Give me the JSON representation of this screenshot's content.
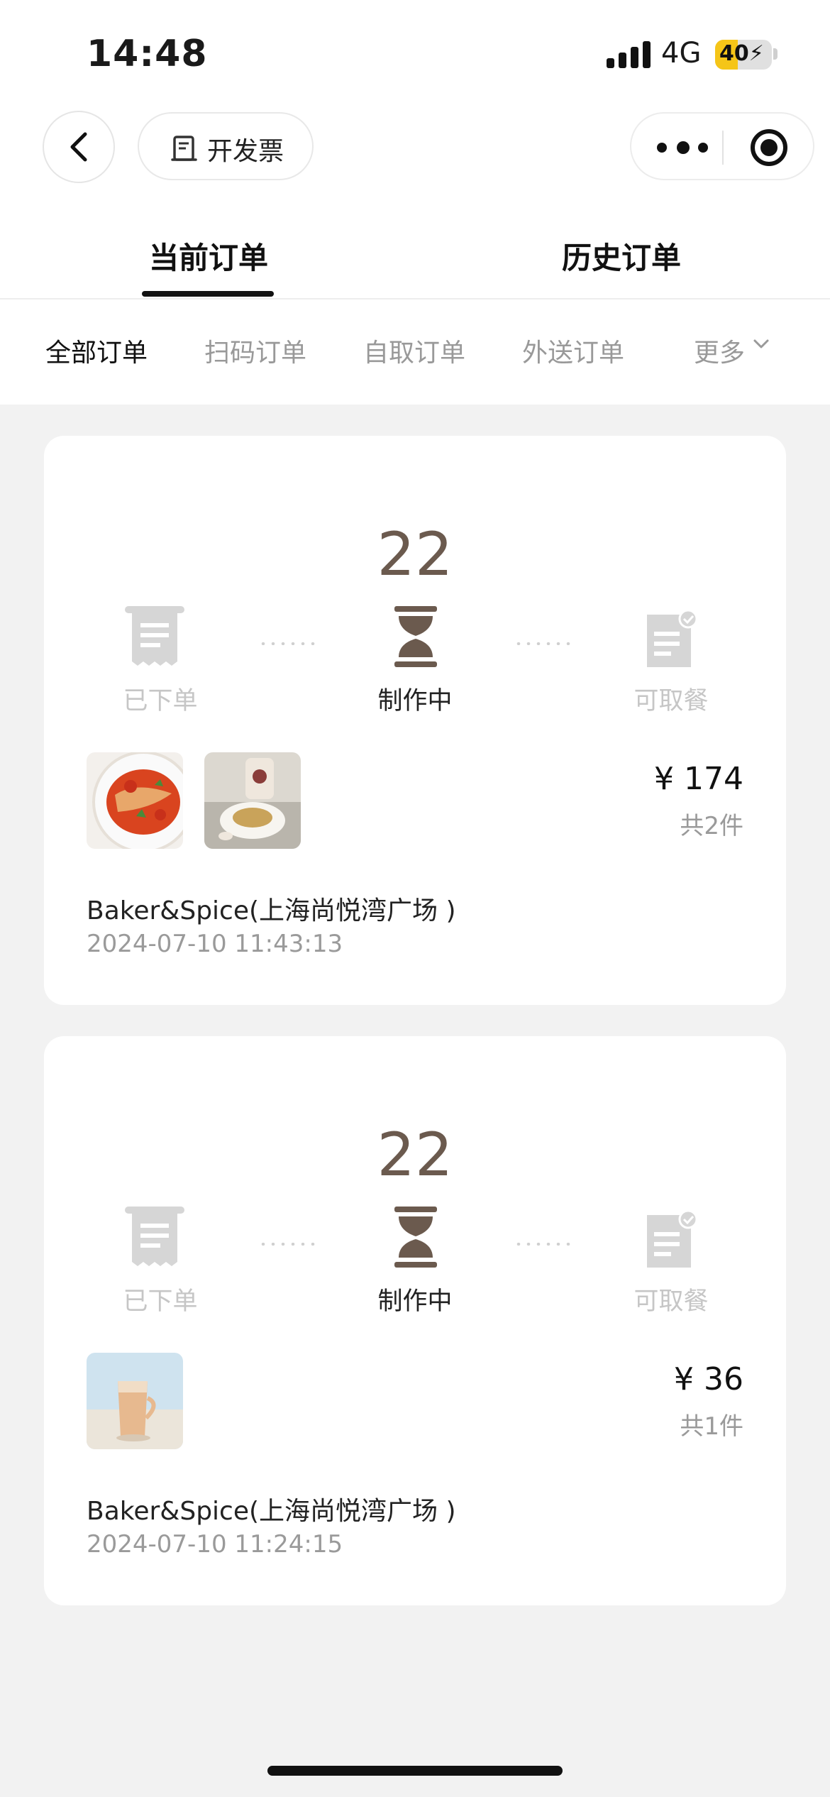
{
  "status_bar": {
    "time": "14:48",
    "network": "4G",
    "battery": "40",
    "battery_level_percent": 40
  },
  "nav": {
    "invoice_label": "开发票",
    "icons": [
      "back-arrow-icon",
      "invoice-icon",
      "more-dots-icon",
      "close-target-icon"
    ]
  },
  "tabs": [
    {
      "label": "当前订单",
      "active": true
    },
    {
      "label": "历史订单",
      "active": false
    }
  ],
  "filters": [
    {
      "label": "全部订单",
      "active": true
    },
    {
      "label": "扫码订单",
      "active": false
    },
    {
      "label": "自取订单",
      "active": false
    },
    {
      "label": "外送订单",
      "active": false
    },
    {
      "label": "更多",
      "active": false
    }
  ],
  "orders": [
    {
      "number": "22",
      "steps": [
        {
          "label": "已下单",
          "active": false
        },
        {
          "label": "制作中",
          "active": true
        },
        {
          "label": "可取餐",
          "active": false
        }
      ],
      "thumbnails": [
        "pasta-dish-image",
        "drink-and-plate-image"
      ],
      "price": "¥ 174",
      "count": "共2件",
      "store": "Baker&Spice(上海尚悦湾广场 )",
      "time": "2024-07-10 11:43:13"
    },
    {
      "number": "22",
      "steps": [
        {
          "label": "已下单",
          "active": false
        },
        {
          "label": "制作中",
          "active": true
        },
        {
          "label": "可取餐",
          "active": false
        }
      ],
      "thumbnails": [
        "iced-latte-image"
      ],
      "price": "¥ 36",
      "count": "共1件",
      "store": "Baker&Spice(上海尚悦湾广场 )",
      "time": "2024-07-10 11:24:15"
    }
  ],
  "colors": {
    "accent_brown": "#6b5a4e",
    "inactive_gray": "#c6c6c6",
    "battery_yellow": "#f5c518"
  }
}
